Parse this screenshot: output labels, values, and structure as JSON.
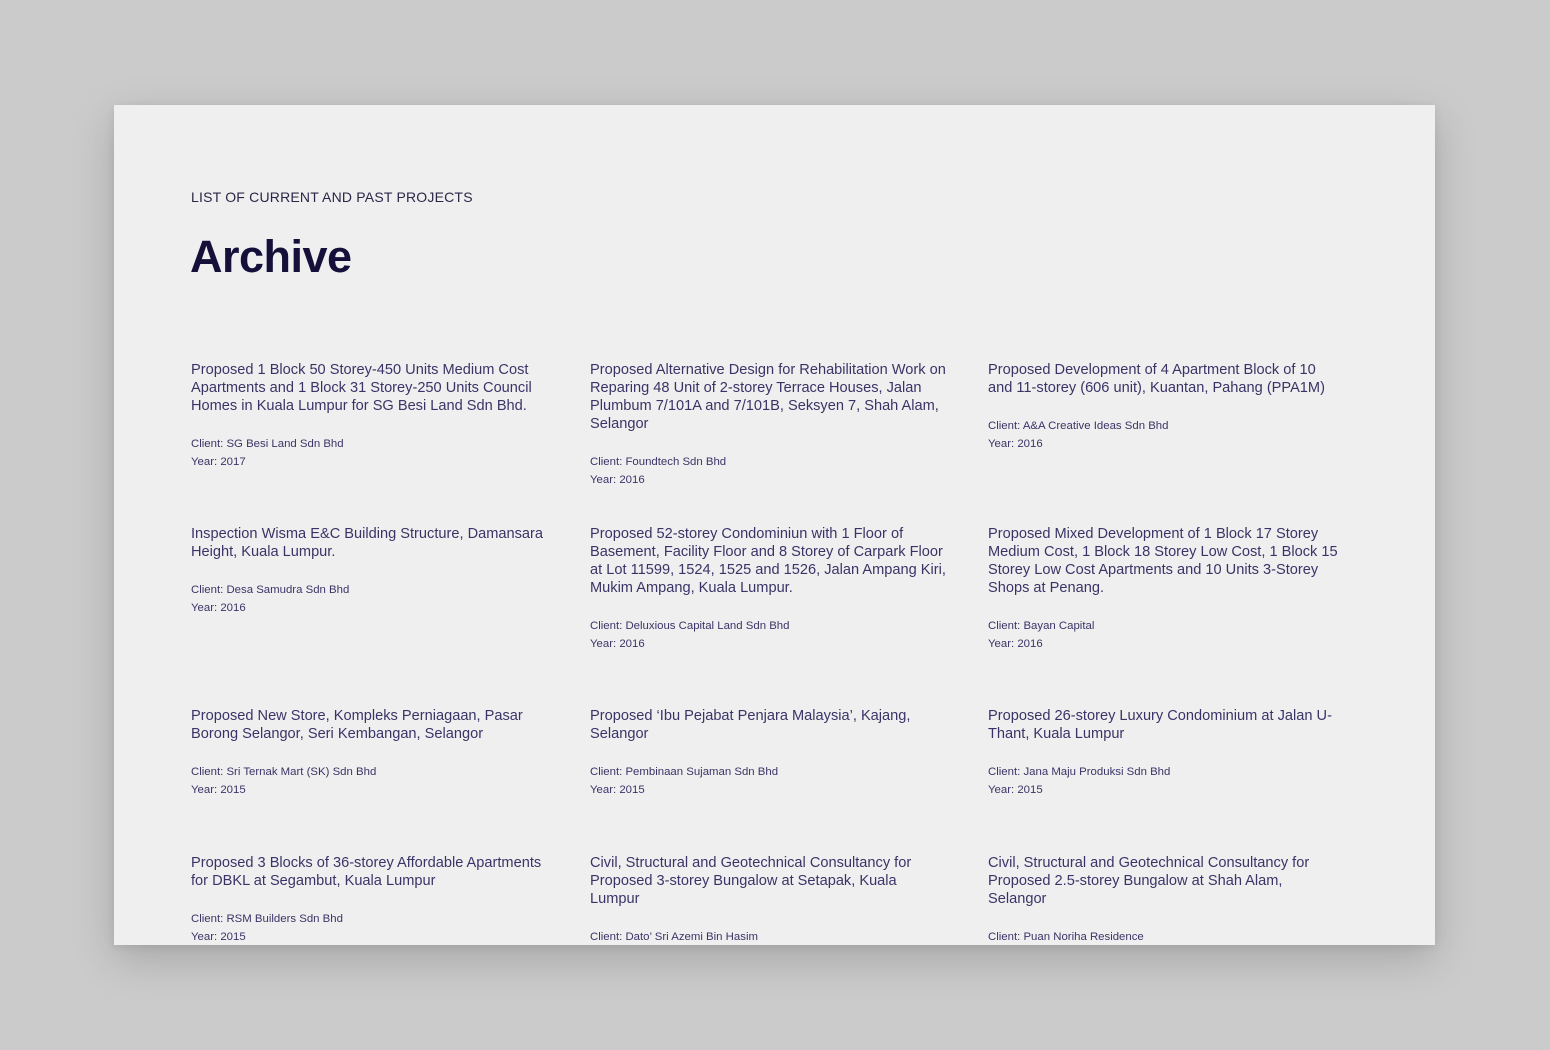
{
  "header": {
    "eyebrow": "LIST OF CURRENT AND PAST PROJECTS",
    "title": "Archive"
  },
  "labels": {
    "client": "Client: ",
    "year": "Year: "
  },
  "projects": [
    {
      "title": "Proposed 1 Block 50 Storey-450 Units Medium Cost Apartments and 1 Block 31 Storey-250 Units Council Homes in Kuala Lumpur for SG Besi Land Sdn Bhd.",
      "client": "SG Besi Land Sdn Bhd",
      "year": "2017"
    },
    {
      "title": "Proposed Alternative Design for Rehabilitation Work on Reparing 48 Unit of 2-storey Terrace Houses, Jalan Plumbum 7/101A and 7/101B, Seksyen 7, Shah Alam, Selangor",
      "client": "Foundtech Sdn Bhd",
      "year": "2016"
    },
    {
      "title": "Proposed Development of 4 Apartment Block of 10 and 11-storey (606 unit), Kuantan, Pahang (PPA1M)",
      "client": "A&A Creative Ideas Sdn Bhd",
      "year": "2016"
    },
    {
      "title": "Inspection Wisma E&C Building Structure, Damansara Height, Kuala Lumpur.",
      "client": "Desa Samudra Sdn Bhd",
      "year": "2016"
    },
    {
      "title": "Proposed 52-storey Condominiun with 1 Floor of Basement, Facility Floor and 8 Storey of Carpark Floor at Lot 11599, 1524, 1525 and 1526, Jalan Ampang Kiri, Mukim Ampang, Kuala Lumpur.",
      "client": "Deluxious Capital Land Sdn Bhd",
      "year": "2016"
    },
    {
      "title": "Proposed Mixed Development of 1 Block 17 Storey Medium Cost, 1 Block 18 Storey Low Cost, 1 Block 15 Storey Low Cost Apartments and 10 Units 3-Storey Shops at Penang.",
      "client": "Bayan Capital",
      "year": "2016"
    },
    {
      "title": "Proposed New Store, Kompleks Perniagaan, Pasar Borong Selangor, Seri Kembangan, Selangor",
      "client": "Sri Ternak Mart (SK) Sdn Bhd",
      "year": "2015"
    },
    {
      "title": "Proposed ‘Ibu Pejabat Penjara Malaysia’, Kajang, Selangor",
      "client": "Pembinaan Sujaman Sdn Bhd",
      "year": "2015"
    },
    {
      "title": "Proposed 26-storey Luxury Condominium at Jalan U-Thant, Kuala Lumpur",
      "client": "Jana Maju Produksi Sdn Bhd",
      "year": "2015"
    },
    {
      "title": "Proposed 3 Blocks of 36-storey Affordable Apartments for DBKL at Segambut, Kuala Lumpur",
      "client": "RSM Builders Sdn Bhd",
      "year": "2015"
    },
    {
      "title": "Civil, Structural and Geotechnical Consultancy for Proposed 3-storey Bungalow at Setapak, Kuala Lumpur",
      "client": "Dato’ Sri Azemi Bin Hasim",
      "year": ""
    },
    {
      "title": "Civil, Structural and Geotechnical Consultancy for Proposed 2.5-storey Bungalow at Shah Alam, Selangor",
      "client": "Puan Noriha Residence",
      "year": ""
    }
  ]
}
